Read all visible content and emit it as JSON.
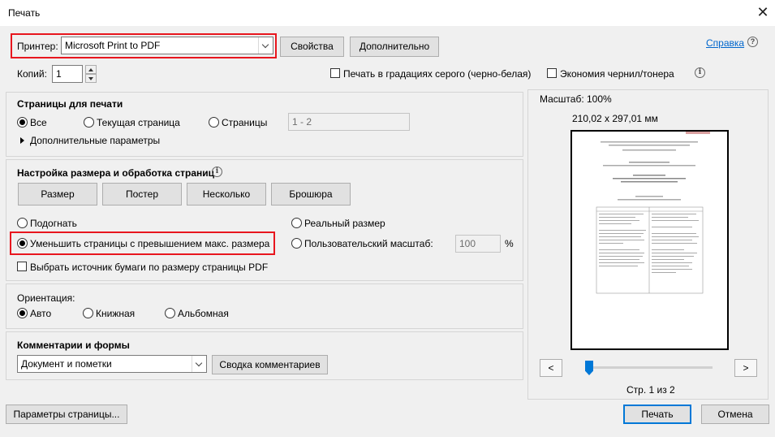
{
  "window": {
    "title": "Печать",
    "close_symbol": "✕"
  },
  "printer": {
    "label": "Принтер:",
    "selected": "Microsoft Print to PDF",
    "properties_label": "Свойства",
    "advanced_label": "Дополнительно",
    "help_label": "Справка",
    "help_icon": "?"
  },
  "copies": {
    "label": "Копий:",
    "value": "1"
  },
  "options": {
    "grayscale_label": "Печать в градациях серого (черно-белая)",
    "grayscale_checked": false,
    "save_ink_label": "Экономия чернил/тонера",
    "save_ink_checked": false,
    "info_icon": "i"
  },
  "pages_to_print": {
    "title": "Страницы для печати",
    "all_label": "Все",
    "current_label": "Текущая страница",
    "pages_label": "Страницы",
    "pages_value": "1 - 2",
    "more_options_label": "Дополнительные параметры",
    "selected": "all"
  },
  "sizing": {
    "title": "Настройка размера и обработка страниц",
    "info_icon": "i",
    "tabs": [
      "Размер",
      "Постер",
      "Несколько",
      "Брошюра"
    ],
    "fit_label": "Подогнать",
    "actual_label": "Реальный размер",
    "shrink_label": "Уменьшить страницы с превышением макс. размера",
    "custom_label": "Пользовательский масштаб:",
    "custom_value": "100",
    "percent": "%",
    "paper_source_label": "Выбрать источник бумаги по размеру страницы PDF",
    "selected": "shrink"
  },
  "orientation": {
    "title": "Ориентация:",
    "auto_label": "Авто",
    "portrait_label": "Книжная",
    "landscape_label": "Альбомная",
    "selected": "auto"
  },
  "comments": {
    "title": "Комментарии и формы",
    "selected": "Документ и пометки",
    "summary_label": "Сводка комментариев"
  },
  "preview": {
    "scale_label": "Масштаб: 100%",
    "dimensions": "210,02 x 297,01 мм",
    "prev_label": "<",
    "next_label": ">",
    "page_indicator": "Стр. 1 из 2"
  },
  "footer": {
    "page_setup_label": "Параметры страницы...",
    "print_label": "Печать",
    "cancel_label": "Отмена"
  },
  "colors": {
    "accent": "#0078d7",
    "highlight": "#e8161e",
    "link": "#0066cc"
  }
}
